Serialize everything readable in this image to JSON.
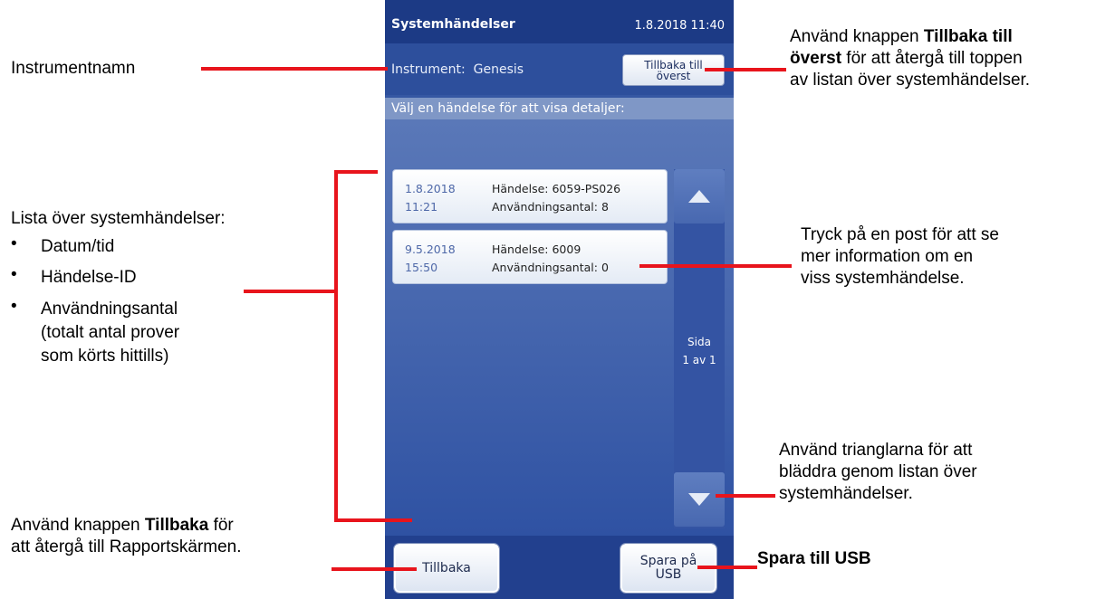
{
  "screen": {
    "title": "Systemhändelser",
    "datetime": "1.8.2018 11:40",
    "instrument_label": "Instrument:",
    "instrument_name": "Genesis",
    "back_to_top_line1": "Tillbaka till",
    "back_to_top_line2": "överst",
    "prompt": "Välj en händelse för att visa detaljer:",
    "events": [
      {
        "date": "1.8.2018",
        "time": "11:21",
        "event": "Händelse: 6059-PS026",
        "usage": "Användningsantal: 8"
      },
      {
        "date": "9.5.2018",
        "time": "15:50",
        "event": "Händelse: 6009",
        "usage": "Användningsantal: 0"
      }
    ],
    "page_label": "Sida",
    "page_value": "1 av 1",
    "back_button": "Tillbaka",
    "save_line1": "Spara på",
    "save_line2": "USB",
    "up_icon": "triangle-up-icon",
    "down_icon": "triangle-down-icon"
  },
  "annotations": {
    "instrument_name": "Instrumentnamn",
    "back_top_pre": "Använd knappen ",
    "back_top_bold1": "Tillbaka till",
    "back_top_bold2": "överst",
    "back_top_post1": " för att återgå till toppen",
    "back_top_post2": "av listan över systemhändelser.",
    "list_title": "Lista över systemhändelser:",
    "list_items": [
      "Datum/tid",
      "Händelse-ID",
      "Användningsantal",
      "(totalt antal prover",
      "som körts hittills)"
    ],
    "tap_line1": "Tryck på en post för att se",
    "tap_line2": "mer information om en",
    "tap_line3": "viss systemhändelse.",
    "tri_line1": "Använd trianglarna för att",
    "tri_line2": "bläddra genom listan över",
    "tri_line3": "systemhändelser.",
    "back_pre": "Använd knappen ",
    "back_bold": "Tillbaka",
    "back_post1": " för",
    "back_post2": "att återgå till Rapportskärmen.",
    "save_usb": "Spara till USB"
  },
  "colors": {
    "screen_bg": "#3658a3",
    "titlebar": "#1c3a85",
    "callout_line": "#e8141c"
  }
}
